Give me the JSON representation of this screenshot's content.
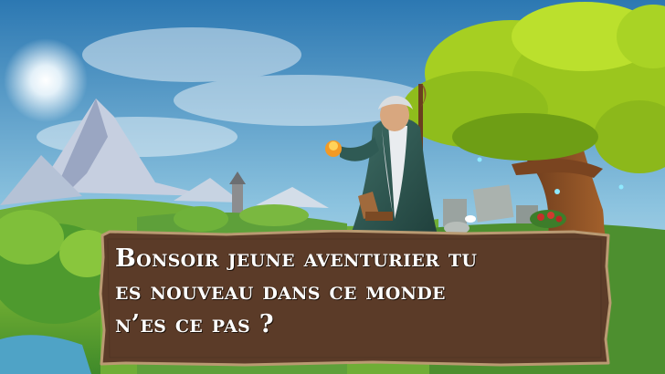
{
  "dialog": {
    "text": "Bonsoir jeune aventurier tu\nes nouveau dans ce monde\nn’es ce pas  ?"
  },
  "colors": {
    "sky_top": "#2f7fb8",
    "sky_bottom": "#cfe7f2",
    "foliage": "#a8cf24",
    "dialog_fill": "#5b3b28",
    "dialog_border": "#b99a72",
    "text": "#ffffff"
  },
  "characters": [
    {
      "name": "wizard",
      "icon": "wizard-character-icon"
    }
  ]
}
